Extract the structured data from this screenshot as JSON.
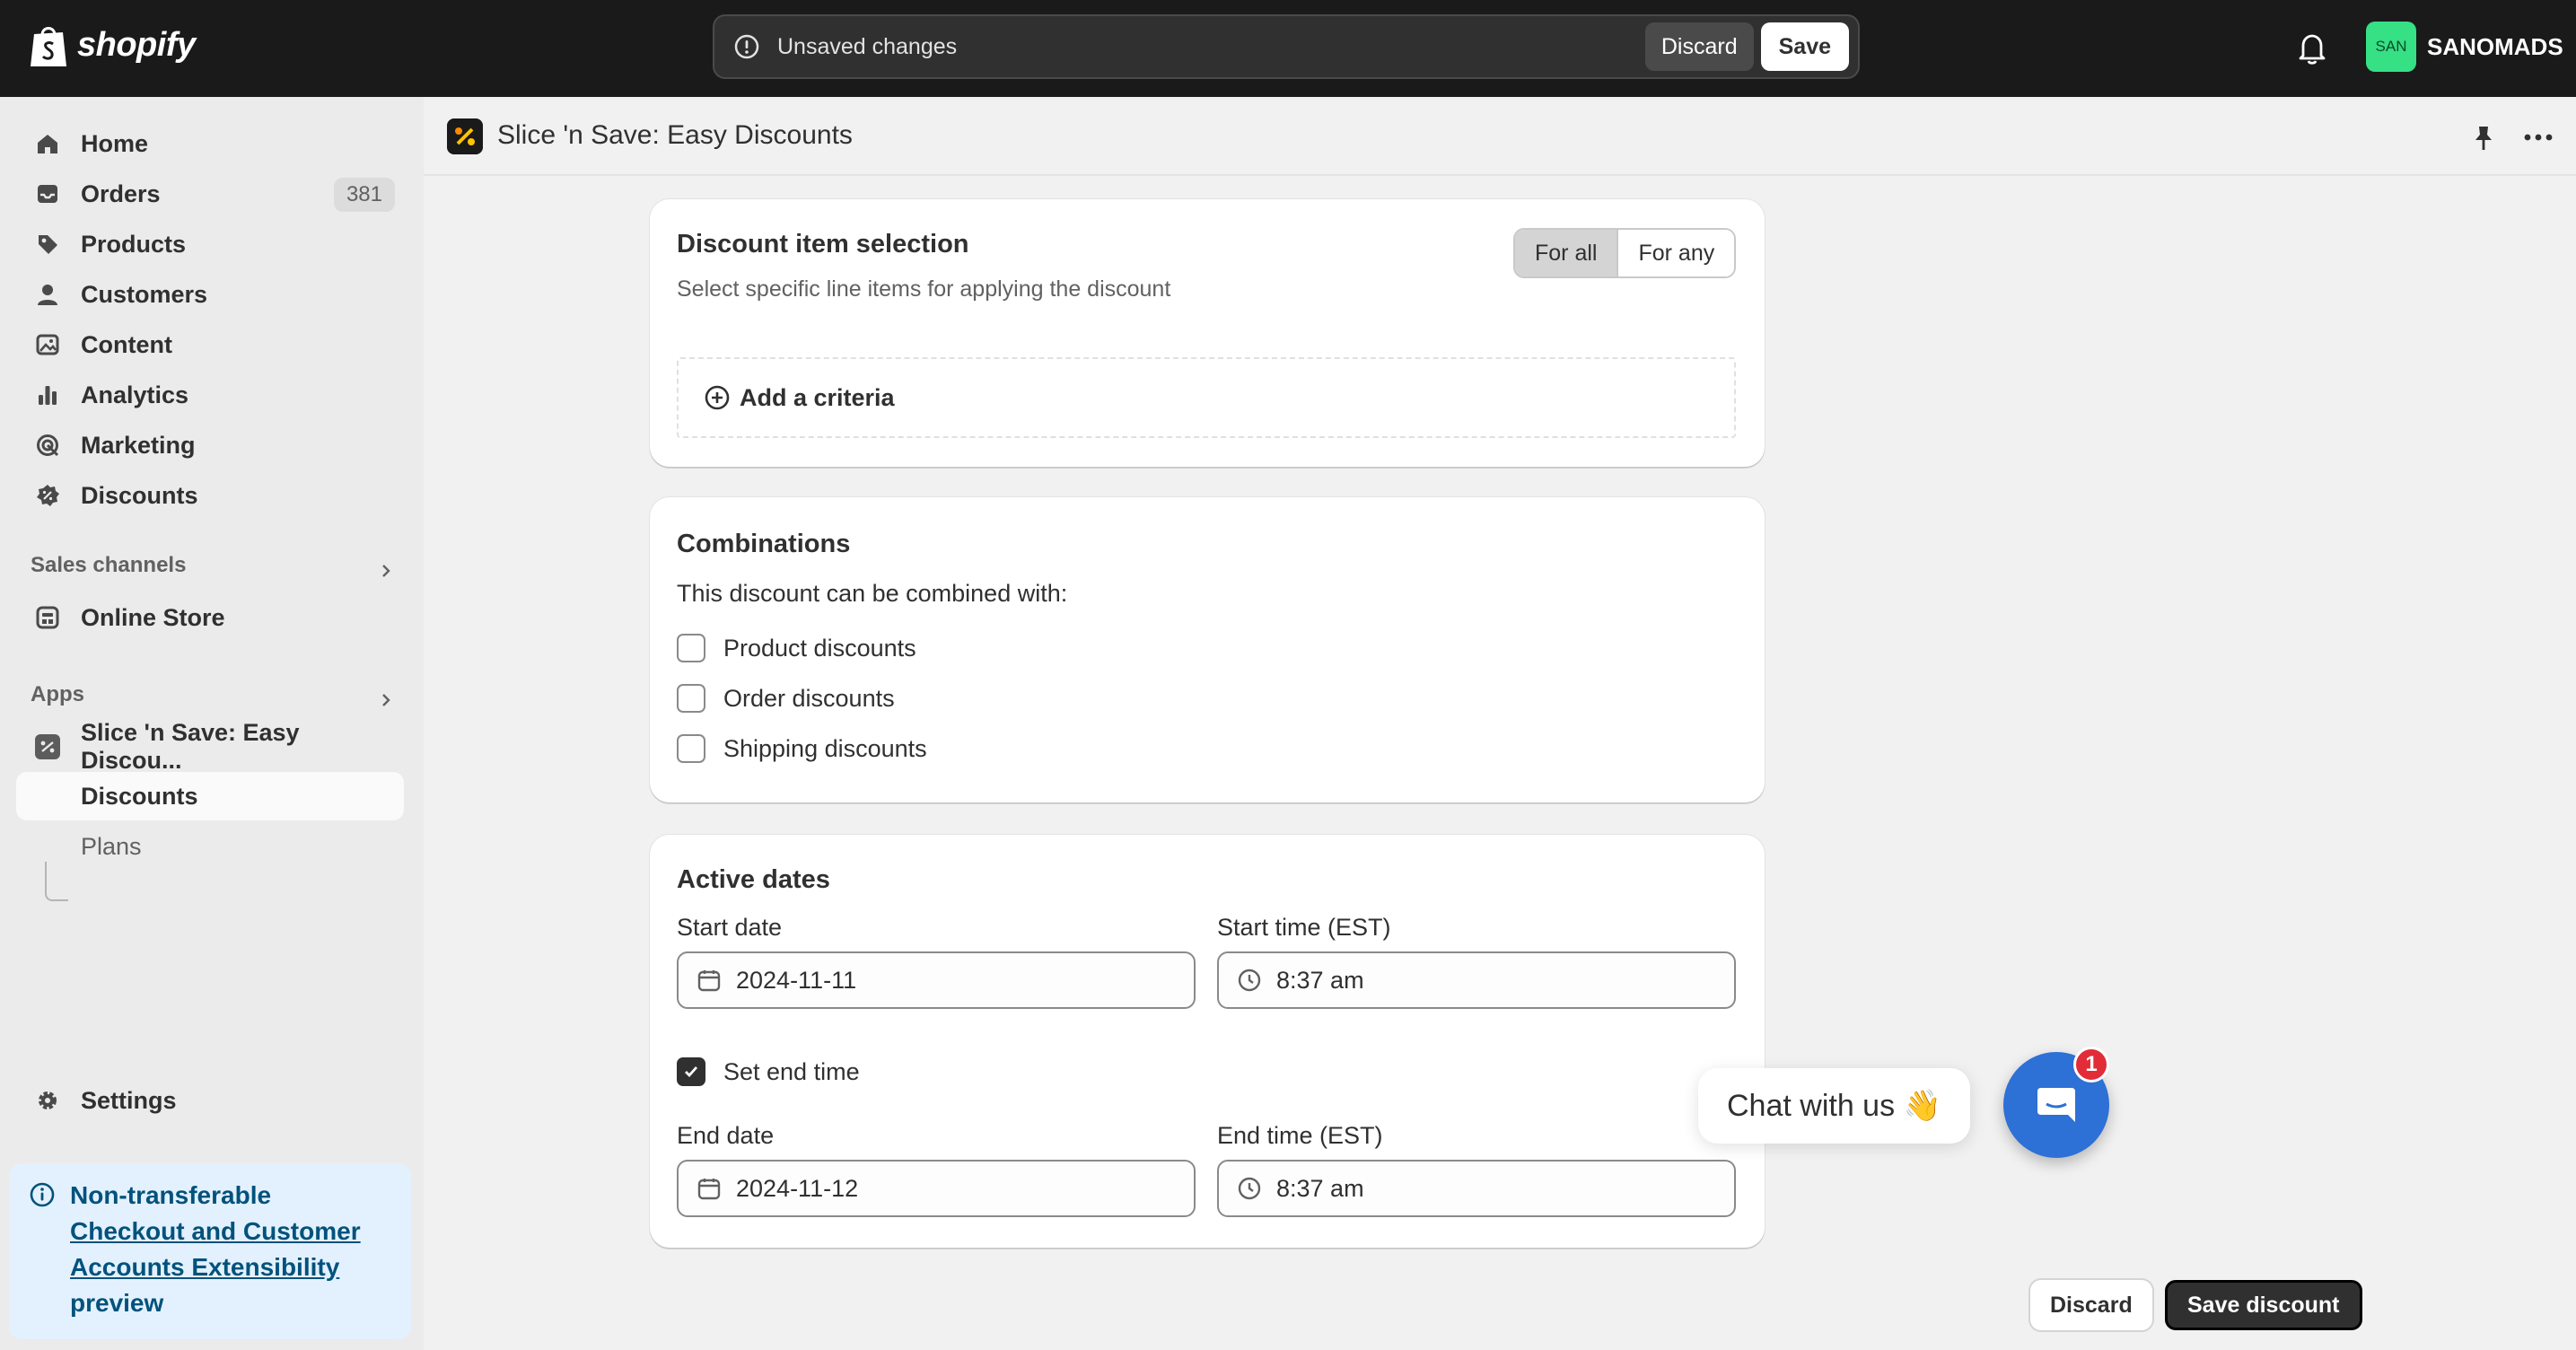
{
  "topbar": {
    "brand": "shopify",
    "unsaved_text": "Unsaved changes",
    "discard_label": "Discard",
    "save_label": "Save",
    "store_initials": "SAN",
    "store_name": "SANOMADS"
  },
  "sidebar": {
    "items": [
      {
        "label": "Home",
        "icon": "home-icon"
      },
      {
        "label": "Orders",
        "icon": "inbox-icon",
        "badge": "381"
      },
      {
        "label": "Products",
        "icon": "tag-icon"
      },
      {
        "label": "Customers",
        "icon": "person-icon"
      },
      {
        "label": "Content",
        "icon": "image-icon"
      },
      {
        "label": "Analytics",
        "icon": "bar-chart-icon"
      },
      {
        "label": "Marketing",
        "icon": "target-icon"
      },
      {
        "label": "Discounts",
        "icon": "discount-icon"
      }
    ],
    "sales_channels_label": "Sales channels",
    "online_store_label": "Online Store",
    "apps_label": "Apps",
    "app_name": "Slice 'n Save: Easy Discou...",
    "app_sub_discounts": "Discounts",
    "app_sub_plans": "Plans",
    "settings_label": "Settings",
    "notice": {
      "title": "Non-transferable",
      "link": "Checkout and Customer Accounts Extensibility",
      "suffix": "preview"
    }
  },
  "header": {
    "app_title": "Slice 'n Save: Easy Discounts"
  },
  "selection": {
    "title": "Discount item selection",
    "subtitle": "Select specific line items for applying the discount",
    "option_all": "For all",
    "option_any": "For any",
    "add_criteria": "Add a criteria"
  },
  "combinations": {
    "title": "Combinations",
    "subtitle": "This discount can be combined with:",
    "product": "Product discounts",
    "order": "Order discounts",
    "shipping": "Shipping discounts"
  },
  "dates": {
    "title": "Active dates",
    "start_date_label": "Start date",
    "start_date_value": "2024-11-11",
    "start_time_label": "Start time (EST)",
    "start_time_value": "8:37 am",
    "set_end_label": "Set end time",
    "end_date_label": "End date",
    "end_date_value": "2024-11-12",
    "end_time_label": "End time (EST)",
    "end_time_value": "8:37 am"
  },
  "footer": {
    "discard_label": "Discard",
    "save_label": "Save discount"
  },
  "chat": {
    "label": "Chat with us 👋",
    "count": "1"
  },
  "colors": {
    "topbar": "#1a1a1a",
    "primary_button": "#303030",
    "store_avatar": "#36e085",
    "chat": "#2d70d6",
    "badge": "#e22c38",
    "notice": "#e3f1fe"
  }
}
